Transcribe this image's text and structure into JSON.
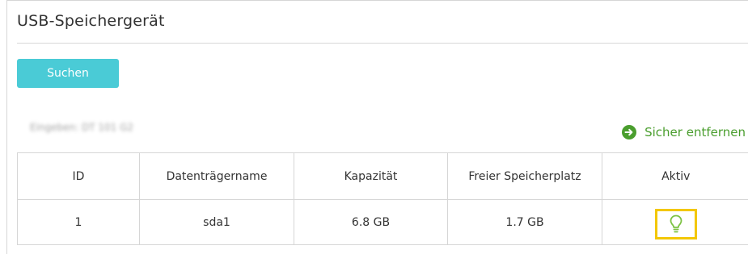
{
  "section": {
    "title": "USB-Speichergerät",
    "search_label": "Suchen",
    "blurred_info": "Eingeben: DT 101 G2",
    "safe_remove_label": "Sicher entfernen"
  },
  "table": {
    "headers": [
      "ID",
      "Datenträgername",
      "Kapazität",
      "Freier Speicherplatz",
      "Aktiv"
    ],
    "rows": [
      {
        "id": "1",
        "name": "sda1",
        "capacity": "6.8 GB",
        "free": "1.7 GB",
        "active_icon": "lightbulb-icon"
      }
    ]
  },
  "colors": {
    "accent_button": "#4acbd6",
    "safe_remove_green": "#4a9e2e",
    "highlight_box": "#f3c700",
    "lightbulb_green": "#7cc242"
  }
}
